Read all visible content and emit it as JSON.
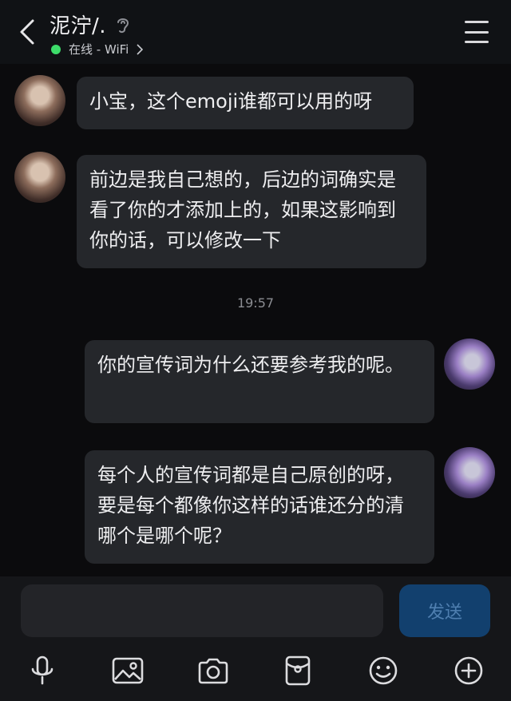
{
  "header": {
    "title": "泥泞/.",
    "status": "在线 - WiFi",
    "status_color": "#3ddc6a"
  },
  "messages": [
    {
      "side": "left",
      "text": "小宝，这个emoji谁都可以用的呀"
    },
    {
      "side": "left",
      "text": "前边是我自己想的，后边的词确实是看了你的才添加上的，如果这影响到你的话，可以修改一下"
    },
    {
      "timestamp": "19:57"
    },
    {
      "side": "right",
      "text": "你的宣传词为什么还要参考我的呢。"
    },
    {
      "side": "right",
      "text": "每个人的宣传词都是自己原创的呀，要是每个都像你这样的话谁还分的清哪个是哪个呢？"
    }
  ],
  "input": {
    "placeholder": "",
    "send_label": "发送"
  },
  "toolbar": {
    "icons": [
      "microphone-icon",
      "image-icon",
      "camera-icon",
      "red-packet-icon",
      "emoji-icon",
      "plus-icon"
    ]
  },
  "colors": {
    "background": "#0b0b0d",
    "bubble": "#25272b",
    "send_button": "#12406e"
  }
}
